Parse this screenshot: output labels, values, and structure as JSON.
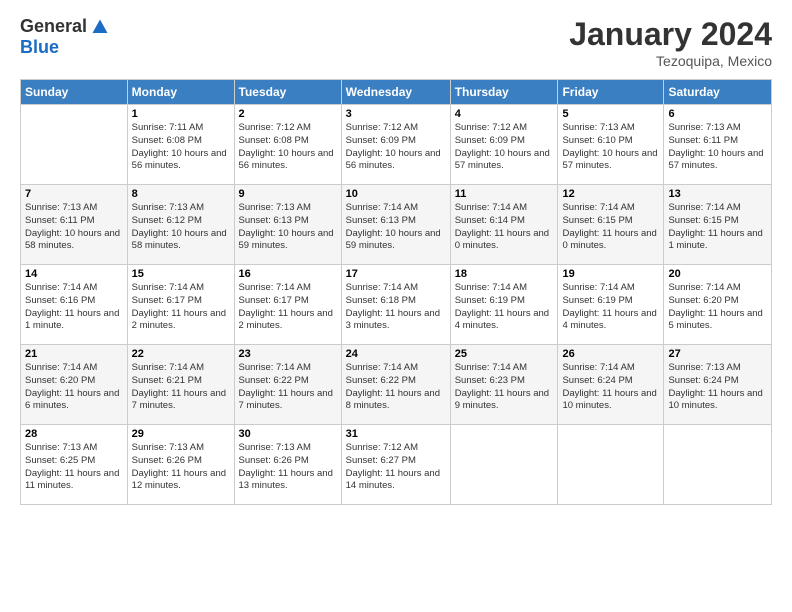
{
  "header": {
    "logo_general": "General",
    "logo_blue": "Blue",
    "month_title": "January 2024",
    "location": "Tezoquipa, Mexico"
  },
  "calendar": {
    "days_of_week": [
      "Sunday",
      "Monday",
      "Tuesday",
      "Wednesday",
      "Thursday",
      "Friday",
      "Saturday"
    ],
    "weeks": [
      [
        {
          "day": "",
          "info": ""
        },
        {
          "day": "1",
          "info": "Sunrise: 7:11 AM\nSunset: 6:08 PM\nDaylight: 10 hours and 56 minutes."
        },
        {
          "day": "2",
          "info": "Sunrise: 7:12 AM\nSunset: 6:08 PM\nDaylight: 10 hours and 56 minutes."
        },
        {
          "day": "3",
          "info": "Sunrise: 7:12 AM\nSunset: 6:09 PM\nDaylight: 10 hours and 56 minutes."
        },
        {
          "day": "4",
          "info": "Sunrise: 7:12 AM\nSunset: 6:09 PM\nDaylight: 10 hours and 57 minutes."
        },
        {
          "day": "5",
          "info": "Sunrise: 7:13 AM\nSunset: 6:10 PM\nDaylight: 10 hours and 57 minutes."
        },
        {
          "day": "6",
          "info": "Sunrise: 7:13 AM\nSunset: 6:11 PM\nDaylight: 10 hours and 57 minutes."
        }
      ],
      [
        {
          "day": "7",
          "info": "Sunrise: 7:13 AM\nSunset: 6:11 PM\nDaylight: 10 hours and 58 minutes."
        },
        {
          "day": "8",
          "info": "Sunrise: 7:13 AM\nSunset: 6:12 PM\nDaylight: 10 hours and 58 minutes."
        },
        {
          "day": "9",
          "info": "Sunrise: 7:13 AM\nSunset: 6:13 PM\nDaylight: 10 hours and 59 minutes."
        },
        {
          "day": "10",
          "info": "Sunrise: 7:14 AM\nSunset: 6:13 PM\nDaylight: 10 hours and 59 minutes."
        },
        {
          "day": "11",
          "info": "Sunrise: 7:14 AM\nSunset: 6:14 PM\nDaylight: 11 hours and 0 minutes."
        },
        {
          "day": "12",
          "info": "Sunrise: 7:14 AM\nSunset: 6:15 PM\nDaylight: 11 hours and 0 minutes."
        },
        {
          "day": "13",
          "info": "Sunrise: 7:14 AM\nSunset: 6:15 PM\nDaylight: 11 hours and 1 minute."
        }
      ],
      [
        {
          "day": "14",
          "info": "Sunrise: 7:14 AM\nSunset: 6:16 PM\nDaylight: 11 hours and 1 minute."
        },
        {
          "day": "15",
          "info": "Sunrise: 7:14 AM\nSunset: 6:17 PM\nDaylight: 11 hours and 2 minutes."
        },
        {
          "day": "16",
          "info": "Sunrise: 7:14 AM\nSunset: 6:17 PM\nDaylight: 11 hours and 2 minutes."
        },
        {
          "day": "17",
          "info": "Sunrise: 7:14 AM\nSunset: 6:18 PM\nDaylight: 11 hours and 3 minutes."
        },
        {
          "day": "18",
          "info": "Sunrise: 7:14 AM\nSunset: 6:19 PM\nDaylight: 11 hours and 4 minutes."
        },
        {
          "day": "19",
          "info": "Sunrise: 7:14 AM\nSunset: 6:19 PM\nDaylight: 11 hours and 4 minutes."
        },
        {
          "day": "20",
          "info": "Sunrise: 7:14 AM\nSunset: 6:20 PM\nDaylight: 11 hours and 5 minutes."
        }
      ],
      [
        {
          "day": "21",
          "info": "Sunrise: 7:14 AM\nSunset: 6:20 PM\nDaylight: 11 hours and 6 minutes."
        },
        {
          "day": "22",
          "info": "Sunrise: 7:14 AM\nSunset: 6:21 PM\nDaylight: 11 hours and 7 minutes."
        },
        {
          "day": "23",
          "info": "Sunrise: 7:14 AM\nSunset: 6:22 PM\nDaylight: 11 hours and 7 minutes."
        },
        {
          "day": "24",
          "info": "Sunrise: 7:14 AM\nSunset: 6:22 PM\nDaylight: 11 hours and 8 minutes."
        },
        {
          "day": "25",
          "info": "Sunrise: 7:14 AM\nSunset: 6:23 PM\nDaylight: 11 hours and 9 minutes."
        },
        {
          "day": "26",
          "info": "Sunrise: 7:14 AM\nSunset: 6:24 PM\nDaylight: 11 hours and 10 minutes."
        },
        {
          "day": "27",
          "info": "Sunrise: 7:13 AM\nSunset: 6:24 PM\nDaylight: 11 hours and 10 minutes."
        }
      ],
      [
        {
          "day": "28",
          "info": "Sunrise: 7:13 AM\nSunset: 6:25 PM\nDaylight: 11 hours and 11 minutes."
        },
        {
          "day": "29",
          "info": "Sunrise: 7:13 AM\nSunset: 6:26 PM\nDaylight: 11 hours and 12 minutes."
        },
        {
          "day": "30",
          "info": "Sunrise: 7:13 AM\nSunset: 6:26 PM\nDaylight: 11 hours and 13 minutes."
        },
        {
          "day": "31",
          "info": "Sunrise: 7:12 AM\nSunset: 6:27 PM\nDaylight: 11 hours and 14 minutes."
        },
        {
          "day": "",
          "info": ""
        },
        {
          "day": "",
          "info": ""
        },
        {
          "day": "",
          "info": ""
        }
      ]
    ]
  }
}
